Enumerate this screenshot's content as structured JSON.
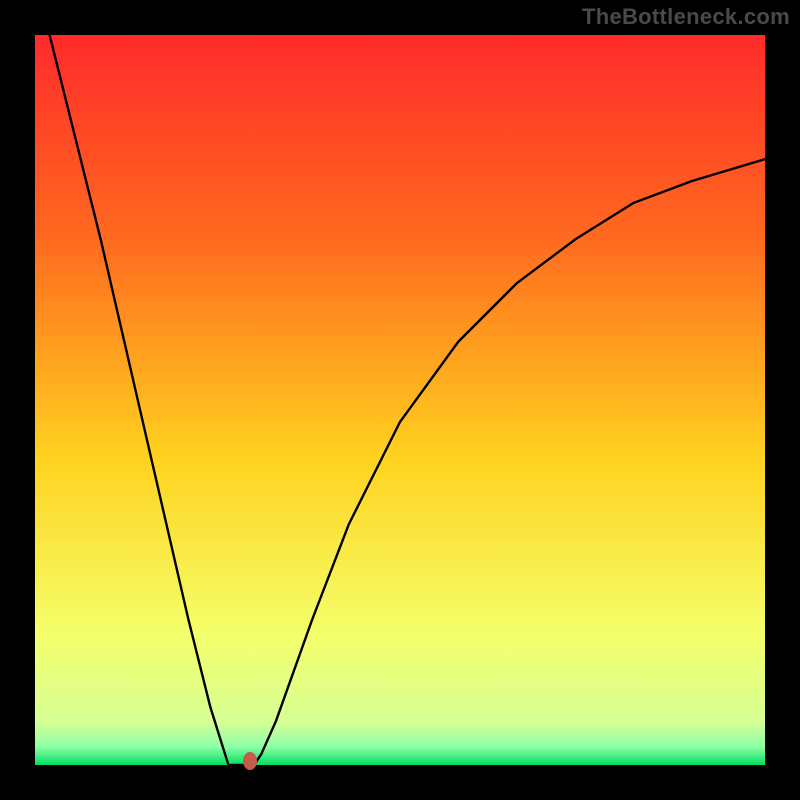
{
  "watermark": "TheBottleneck.com",
  "colors": {
    "frame": "#000000",
    "gradient_top": "#ff2b2b",
    "gradient_upper": "#ff6a1f",
    "gradient_mid": "#ffd21f",
    "gradient_low": "#f4ff6a",
    "gradient_green_light": "#9dffb0",
    "gradient_green": "#00e060",
    "curve": "#000000",
    "marker": "#c85a4a"
  },
  "chart_data": {
    "type": "line",
    "title": "",
    "xlabel": "",
    "ylabel": "",
    "xlim": [
      0,
      1
    ],
    "ylim": [
      0,
      1
    ],
    "x": [
      0.0,
      0.03,
      0.06,
      0.09,
      0.12,
      0.15,
      0.18,
      0.21,
      0.24,
      0.265,
      0.28,
      0.3,
      0.31,
      0.33,
      0.38,
      0.43,
      0.5,
      0.58,
      0.66,
      0.74,
      0.82,
      0.9,
      1.0
    ],
    "values": [
      1.08,
      0.96,
      0.84,
      0.72,
      0.59,
      0.46,
      0.33,
      0.2,
      0.08,
      0.0,
      0.0,
      0.0,
      0.015,
      0.06,
      0.2,
      0.33,
      0.47,
      0.58,
      0.66,
      0.72,
      0.77,
      0.8,
      0.83
    ],
    "marker": {
      "x": 0.295,
      "y": 0.005
    },
    "gradient_stops": [
      {
        "offset": 0.0,
        "color": "#ff2b2b"
      },
      {
        "offset": 0.28,
        "color": "#ff6a1f"
      },
      {
        "offset": 0.58,
        "color": "#ffd21f"
      },
      {
        "offset": 0.82,
        "color": "#f4ff6a"
      },
      {
        "offset": 0.94,
        "color": "#d7ff94"
      },
      {
        "offset": 0.975,
        "color": "#8effa6"
      },
      {
        "offset": 1.0,
        "color": "#00e060"
      }
    ]
  }
}
